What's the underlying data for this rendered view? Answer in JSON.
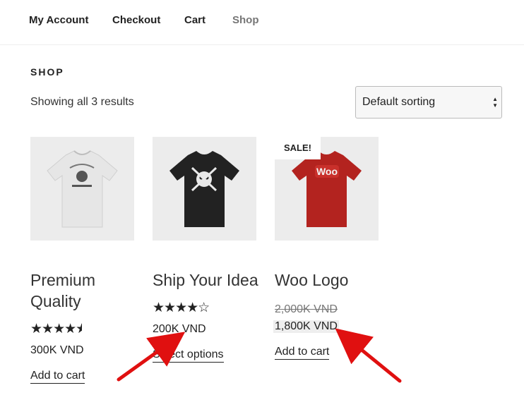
{
  "nav": {
    "items": [
      {
        "label": "My Account"
      },
      {
        "label": "Checkout"
      },
      {
        "label": "Cart"
      },
      {
        "label": "Shop"
      }
    ]
  },
  "shop": {
    "title": "SHOP",
    "result_count": "Showing all 3 results",
    "sorting": {
      "selected": "Default sorting"
    }
  },
  "products": [
    {
      "title_line1": "Premium",
      "title_line2": "Quality",
      "rating_stars": 4.5,
      "price": "300K VND",
      "action": "Add to cart",
      "shirt_color": "#e6e6e6"
    },
    {
      "title": "Ship Your Idea",
      "rating_stars": 4.5,
      "price": "200K VND",
      "action": "Select options",
      "shirt_color": "#222222"
    },
    {
      "title": "Woo Logo",
      "badge": "SALE!",
      "old_price": "2,000K VND",
      "sale_price": "1,800K VND",
      "action": "Add to cart",
      "shirt_color": "#b3231f",
      "shirt_text": "Woo"
    }
  ],
  "colors": {
    "arrow": "#e01010",
    "text": "#222222",
    "thumb_bg": "#ececec"
  }
}
